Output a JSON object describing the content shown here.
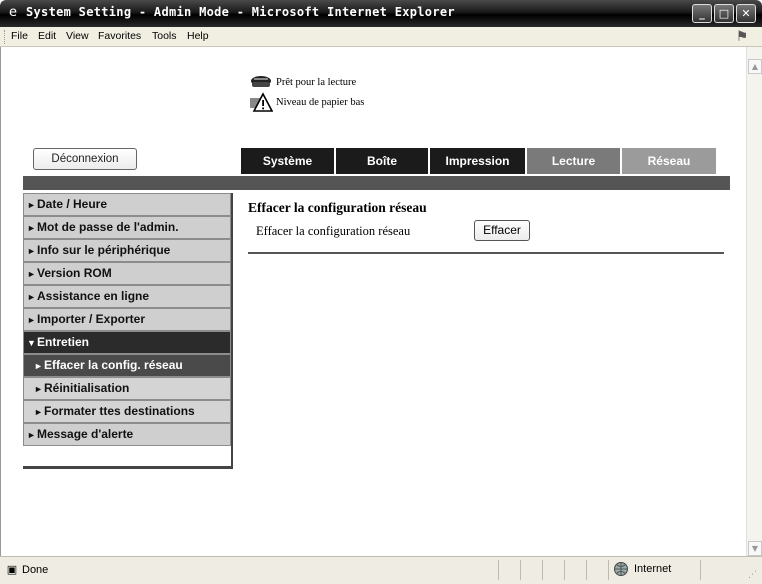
{
  "window": {
    "title": "System Setting - Admin Mode - Microsoft Internet Explorer",
    "controls": {
      "minimize": "_",
      "maximize": "□",
      "close": "✕"
    }
  },
  "menubar": {
    "items": [
      "File",
      "Edit",
      "View",
      "Favorites",
      "Tools",
      "Help"
    ]
  },
  "status_icons": {
    "ready": {
      "text": "Prêt pour la lecture",
      "icon": "scanner-ready-icon"
    },
    "paper_low": {
      "text": "Niveau de papier bas",
      "icon": "paper-low-warning-icon"
    }
  },
  "header": {
    "logout_label": "Déconnexion"
  },
  "tabs": [
    {
      "label": "Système",
      "state": "active"
    },
    {
      "label": "Boîte",
      "state": "normal"
    },
    {
      "label": "Impression",
      "state": "normal"
    },
    {
      "label": "Lecture",
      "state": "normal"
    },
    {
      "label": "Réseau",
      "state": "normal"
    }
  ],
  "sidebar": {
    "items": [
      {
        "label": "Date / Heure",
        "marker": "►"
      },
      {
        "label": "Mot de passe de l'admin.",
        "marker": "►"
      },
      {
        "label": "Info sur le périphérique",
        "marker": "►"
      },
      {
        "label": "Version ROM",
        "marker": "►"
      },
      {
        "label": "Assistance en ligne",
        "marker": "►"
      },
      {
        "label": "Importer / Exporter",
        "marker": "►"
      },
      {
        "label": "Entretien",
        "marker": "▼"
      },
      {
        "label": "Effacer la config. réseau",
        "marker": "►"
      },
      {
        "label": "Réinitialisation",
        "marker": "►"
      },
      {
        "label": "Formater ttes destinations",
        "marker": "►"
      },
      {
        "label": "Message d'alerte",
        "marker": "►"
      }
    ]
  },
  "main": {
    "heading": "Effacer la configuration réseau",
    "row_label": "Effacer la configuration réseau",
    "clear_button": "Effacer"
  },
  "statusbar": {
    "status": "Done",
    "zone": "Internet"
  },
  "colors": {
    "tab_active": "#1b1b1b",
    "tab_gray": "#7a7a7a",
    "tab_light": "#9b9b9b",
    "sidebar_bg": "#cfcfcf",
    "sidebar_open": "#2b2b2b"
  }
}
